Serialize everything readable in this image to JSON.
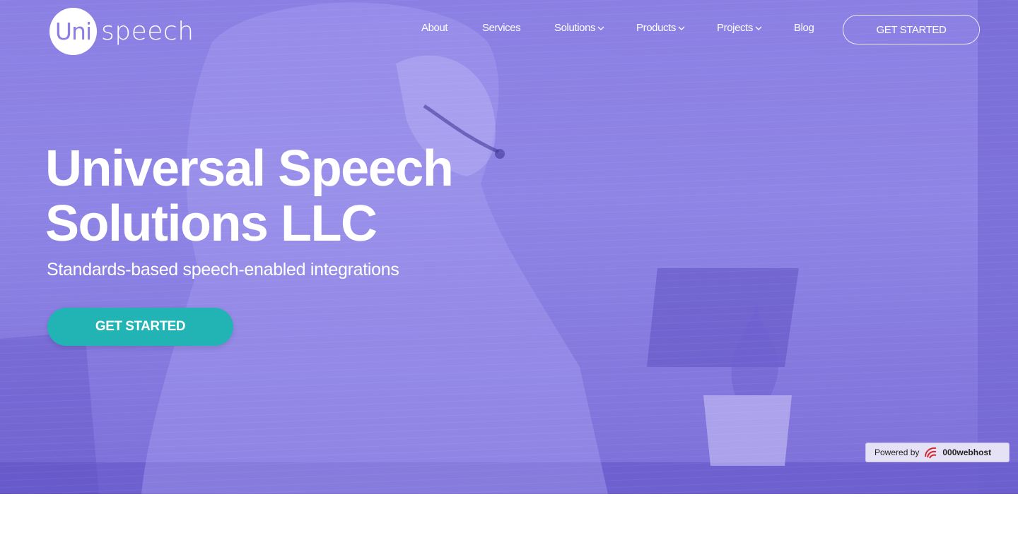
{
  "brand": {
    "logo_mark": "Uni",
    "logo_word": "speech"
  },
  "nav": {
    "items": [
      {
        "label": "About"
      },
      {
        "label": "Services"
      },
      {
        "label": "Solutions"
      },
      {
        "label": "Products"
      },
      {
        "label": "Projects"
      },
      {
        "label": "Blog"
      }
    ],
    "cta_label": "GET STARTED"
  },
  "hero": {
    "title": "Universal Speech Solutions LLC",
    "subtitle": "Standards-based speech-enabled integrations",
    "cta_label": "GET STARTED"
  },
  "badge": {
    "prefix": "Powered by",
    "host": "000webhost"
  },
  "colors": {
    "hero_overlay": "#8b7fe3",
    "cta_teal": "#22b3b5",
    "white": "#ffffff"
  },
  "icons": {
    "dropdown": "chevron-down-icon",
    "host_logo": "webhost-swirl-icon"
  }
}
